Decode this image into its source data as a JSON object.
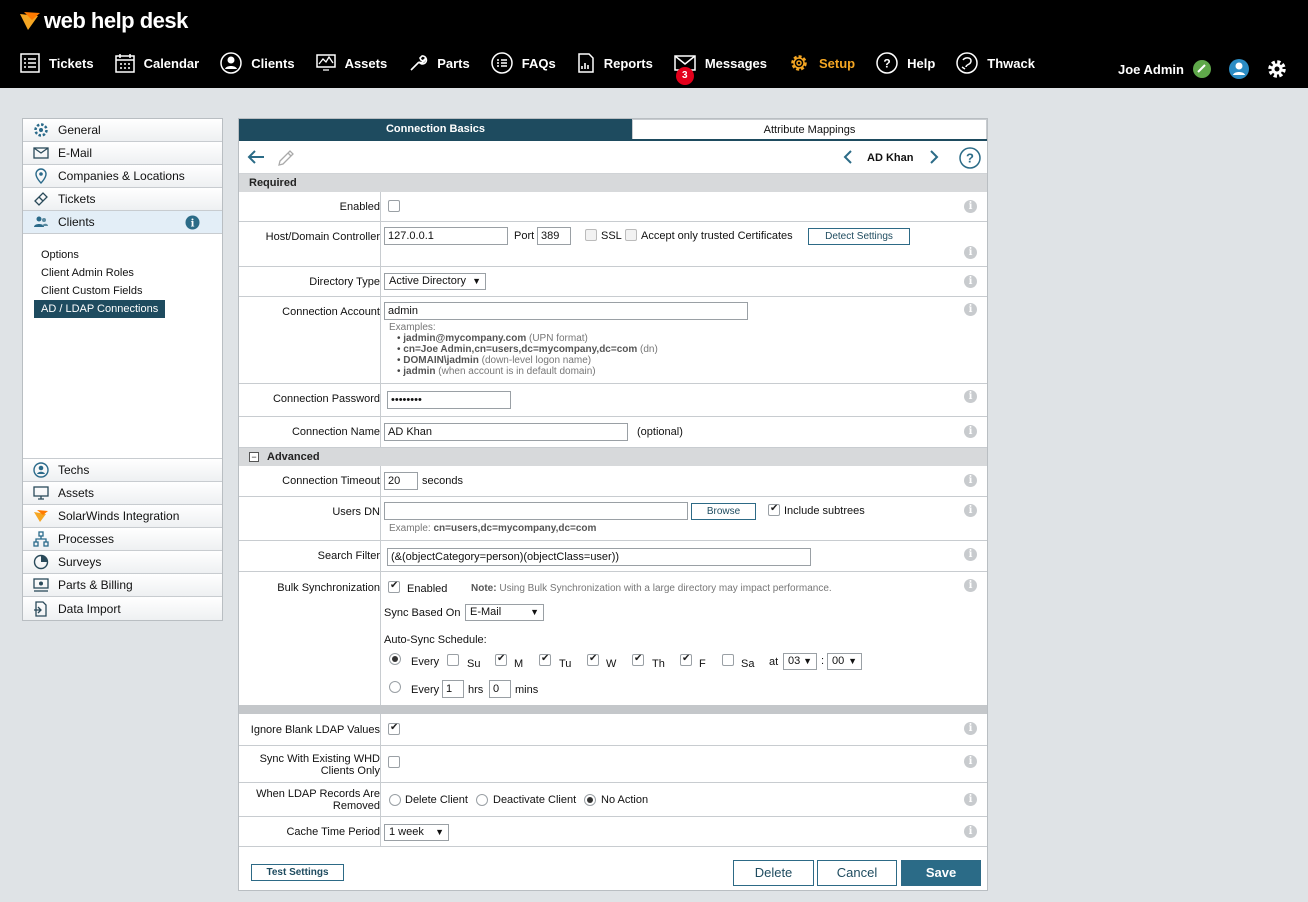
{
  "app": {
    "name": "web help desk"
  },
  "nav": [
    {
      "label": "Tickets",
      "icon": "list-icon"
    },
    {
      "label": "Calendar",
      "icon": "calendar-icon"
    },
    {
      "label": "Clients",
      "icon": "user-icon"
    },
    {
      "label": "Assets",
      "icon": "monitor-icon"
    },
    {
      "label": "Parts",
      "icon": "wrench-icon"
    },
    {
      "label": "FAQs",
      "icon": "faq-icon"
    },
    {
      "label": "Reports",
      "icon": "report-icon"
    },
    {
      "label": "Messages",
      "icon": "envelope-icon",
      "badge": "3"
    },
    {
      "label": "Setup",
      "icon": "gear-icon",
      "active": true
    },
    {
      "label": "Help",
      "icon": "question-icon"
    },
    {
      "label": "Thwack",
      "icon": "thwack-icon"
    }
  ],
  "user": {
    "name": "Joe Admin"
  },
  "sidebar": {
    "items_top": [
      {
        "label": "General",
        "icon": "gear-icon"
      },
      {
        "label": "E-Mail",
        "icon": "envelope-icon"
      },
      {
        "label": "Companies & Locations",
        "icon": "location-pin-icon"
      },
      {
        "label": "Tickets",
        "icon": "ticket-icon"
      },
      {
        "label": "Clients",
        "icon": "users-icon"
      }
    ],
    "sub_items": [
      "Options",
      "Client Admin Roles",
      "Client Custom Fields",
      "AD / LDAP Connections"
    ],
    "items_bottom": [
      {
        "label": "Techs",
        "icon": "user-circle-icon"
      },
      {
        "label": "Assets",
        "icon": "monitor-icon"
      },
      {
        "label": "SolarWinds Integration",
        "icon": "solarwinds-icon"
      },
      {
        "label": "Processes",
        "icon": "process-icon"
      },
      {
        "label": "Surveys",
        "icon": "pie-icon"
      },
      {
        "label": "Parts & Billing",
        "icon": "billing-icon"
      },
      {
        "label": "Data Import",
        "icon": "import-icon"
      }
    ]
  },
  "tabs": {
    "active": "Connection Basics",
    "other": "Attribute Mappings"
  },
  "record": {
    "name": "AD Khan"
  },
  "sections": {
    "required": "Required",
    "advanced": "Advanced"
  },
  "form": {
    "enabled_label": "Enabled",
    "host_label": "Host/Domain Controller",
    "host_value": "127.0.0.1",
    "port_label": "Port",
    "port_value": "389",
    "ssl_label": "SSL",
    "trusted_label": "Accept only trusted Certificates",
    "detect_label": "Detect Settings",
    "dirtype_label": "Directory Type",
    "dirtype_value": "Active Directory",
    "account_label": "Connection Account",
    "account_value": "admin",
    "examples_title": "Examples:",
    "examples": [
      {
        "b": "jadmin@mycompany.com",
        "t": " (UPN format)"
      },
      {
        "b": "cn=Joe Admin,cn=users,dc=mycompany,dc=com",
        "t": " (dn)"
      },
      {
        "b": "DOMAIN\\jadmin",
        "t": " (down-level logon name)"
      },
      {
        "b": "jadmin",
        "t": " (when account is in default domain)"
      }
    ],
    "password_label": "Connection Password",
    "password_value": "••••••••",
    "connname_label": "Connection Name",
    "connname_value": "AD Khan",
    "optional": "(optional)",
    "timeout_label": "Connection Timeout",
    "timeout_value": "20",
    "seconds": "seconds",
    "usersdn_label": "Users DN",
    "usersdn_value": "",
    "browse_label": "Browse",
    "subtrees_label": "Include subtrees",
    "usersdn_example_prefix": "Example: ",
    "usersdn_example": "cn=users,dc=mycompany,dc=com",
    "filter_label": "Search Filter",
    "filter_value": "(&(objectCategory=person)(objectClass=user))",
    "bulk_label": "Bulk Synchronization",
    "bulk_enabled": "Enabled",
    "note_bold": "Note:",
    "note_text": " Using Bulk Synchronization with a large directory may impact performance.",
    "syncon_label": "Sync Based On",
    "syncon_value": "E-Mail",
    "autosync_label": "Auto-Sync Schedule:",
    "every": "Every",
    "days": [
      {
        "d": "Su",
        "on": false
      },
      {
        "d": "M",
        "on": true
      },
      {
        "d": "Tu",
        "on": true
      },
      {
        "d": "W",
        "on": true
      },
      {
        "d": "Th",
        "on": true
      },
      {
        "d": "F",
        "on": true
      },
      {
        "d": "Sa",
        "on": false
      }
    ],
    "at": "at",
    "hour": "03",
    "colon": ":",
    "minute": "00",
    "every_hrs": "1",
    "hrs": "hrs",
    "every_mins": "0",
    "mins": "mins",
    "ignore_label": "Ignore Blank LDAP Values",
    "syncexisting_label": "Sync With Existing WHD Clients Only",
    "removed_label": "When LDAP Records Are Removed",
    "removed_options": [
      "Delete Client",
      "Deactivate Client",
      "No Action"
    ],
    "cache_label": "Cache Time Period",
    "cache_value": "1 week"
  },
  "footer": {
    "test": "Test Settings",
    "delete": "Delete",
    "cancel": "Cancel",
    "save": "Save"
  },
  "colors": {
    "header": "#000000",
    "accent": "#f5a623",
    "primary": "#1e4b5f",
    "badge": "#e4001b"
  }
}
